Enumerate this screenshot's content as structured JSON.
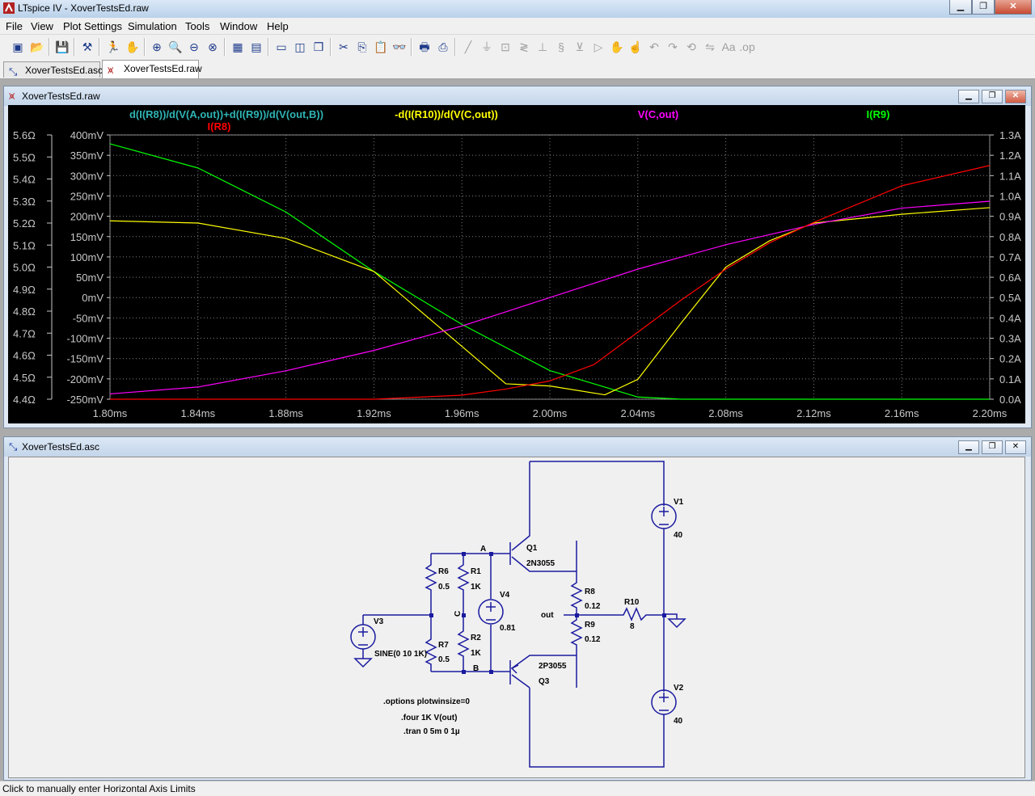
{
  "app": {
    "title": "LTspice IV - XoverTestsEd.raw"
  },
  "menu": [
    "File",
    "View",
    "Plot Settings",
    "Simulation",
    "Tools",
    "Window",
    "Help"
  ],
  "tabs": [
    {
      "label": "XoverTestsEd.asc",
      "icon": "schematic-icon"
    },
    {
      "label": "XoverTestsEd.raw",
      "icon": "waveform-icon"
    }
  ],
  "plot_window": {
    "title": "XoverTestsEd.raw"
  },
  "schematic_window": {
    "title": "XoverTestsEd.asc"
  },
  "status": {
    "text": "Click to manually enter Horizontal Axis Limits"
  },
  "colors": {
    "cyan": "#2fb3b3",
    "yellow": "#ffff00",
    "magenta": "#ff00ff",
    "green": "#00ff00",
    "red": "#ff0000",
    "grid": "#808080",
    "wire": "#1a1aa0"
  },
  "chart_data": {
    "type": "line",
    "title": "",
    "xlabel": "",
    "ylabel": "",
    "x_ticks": [
      "1.80ms",
      "1.84ms",
      "1.88ms",
      "1.92ms",
      "1.96ms",
      "2.00ms",
      "2.04ms",
      "2.08ms",
      "2.12ms",
      "2.16ms",
      "2.20ms"
    ],
    "xlim": [
      1.8,
      2.2
    ],
    "left_ticks": [
      "5.6Ω",
      "5.5Ω",
      "5.4Ω",
      "5.3Ω",
      "5.2Ω",
      "5.1Ω",
      "5.0Ω",
      "4.9Ω",
      "4.8Ω",
      "4.7Ω",
      "4.6Ω",
      "4.5Ω",
      "4.4Ω"
    ],
    "left_ylim": [
      4.4,
      5.6
    ],
    "mid_ticks": [
      "400mV",
      "350mV",
      "300mV",
      "250mV",
      "200mV",
      "150mV",
      "100mV",
      "50mV",
      "0mV",
      "-50mV",
      "-100mV",
      "-150mV",
      "-200mV",
      "-250mV"
    ],
    "mid_ylim": [
      -250,
      400
    ],
    "right_ticks": [
      "1.3A",
      "1.2A",
      "1.1A",
      "1.0A",
      "0.9A",
      "0.8A",
      "0.7A",
      "0.6A",
      "0.5A",
      "0.4A",
      "0.3A",
      "0.2A",
      "0.1A",
      "0.0A"
    ],
    "right_ylim": [
      0,
      1.3
    ],
    "grid": true,
    "series": [
      {
        "name": "d(I(R8))/d(V(A,out))+d(I(R9))/d(V(out,B))",
        "axis": "left",
        "color": "#00ff00",
        "x": [
          1.8,
          1.84,
          1.88,
          1.92,
          1.96,
          2.0,
          2.04,
          2.06,
          2.08,
          2.2
        ],
        "y": [
          5.56,
          5.45,
          5.25,
          4.98,
          4.74,
          4.53,
          4.41,
          4.4,
          4.4,
          4.4
        ]
      },
      {
        "name": "-d(I(R10))/d(V(C,out))",
        "axis": "left",
        "color": "#ffff00",
        "x": [
          1.8,
          1.84,
          1.88,
          1.92,
          1.96,
          1.98,
          2.0,
          2.025,
          2.04,
          2.06,
          2.08,
          2.1,
          2.12,
          2.16,
          2.2
        ],
        "y": [
          5.21,
          5.2,
          5.13,
          4.98,
          4.64,
          4.47,
          4.46,
          4.42,
          4.49,
          4.75,
          5.0,
          5.12,
          5.2,
          5.24,
          5.27
        ]
      },
      {
        "name": "V(C,out)",
        "axis": "mid",
        "color": "#ff00ff",
        "x": [
          1.8,
          1.84,
          1.88,
          1.92,
          1.96,
          2.0,
          2.04,
          2.08,
          2.12,
          2.16,
          2.2
        ],
        "y": [
          -237,
          -220,
          -180,
          -130,
          -70,
          0,
          70,
          130,
          180,
          220,
          237
        ]
      },
      {
        "name": "I(R8)",
        "axis": "right",
        "color": "#ff0000",
        "x": [
          1.8,
          1.92,
          1.96,
          1.98,
          2.0,
          2.02,
          2.04,
          2.06,
          2.08,
          2.1,
          2.12,
          2.16,
          2.2
        ],
        "y": [
          0,
          0,
          0.02,
          0.05,
          0.09,
          0.17,
          0.33,
          0.49,
          0.64,
          0.77,
          0.87,
          1.05,
          1.15
        ]
      }
    ]
  },
  "schematic": {
    "labels": {
      "Q1": "Q1",
      "Q1m": "2N3055",
      "Q3": "Q3",
      "Q3m": "2P3055",
      "R6": "R6",
      "R6v": "0.5",
      "R1": "R1",
      "R1v": "1K",
      "R2": "R2",
      "R2v": "1K",
      "R7": "R7",
      "R7v": "0.5",
      "V4": "V4",
      "V4v": "0.81",
      "V3": "V3",
      "V3v": "SINE(0 10 1K)",
      "R8": "R8",
      "R8v": "0.12",
      "R9": "R9",
      "R9v": "0.12",
      "R10": "R10",
      "R10v": "8",
      "V1": "V1",
      "V1v": "40",
      "V2": "V2",
      "V2v": "40",
      "A": "A",
      "B": "B",
      "C": "C",
      "out": "out",
      "d1": ".options plotwinsize=0",
      "d2": ".four 1K V(out)",
      "d3": ".tran 0 5m 0 1µ"
    }
  }
}
